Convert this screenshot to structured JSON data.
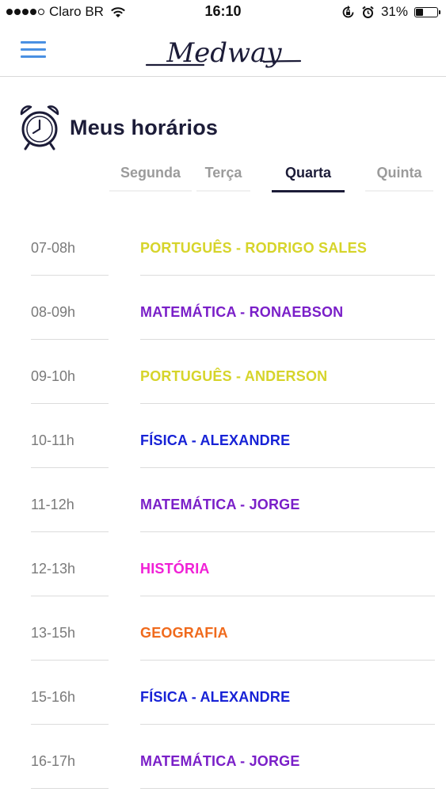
{
  "status_bar": {
    "carrier": "Claro BR",
    "time": "16:10",
    "battery_text": "31%",
    "battery_level": 0.31
  },
  "nav": {
    "logo_text": "Medway"
  },
  "page": {
    "title": "Meus horários"
  },
  "tabs": [
    {
      "label": "Segunda",
      "active": false
    },
    {
      "label": "Terça",
      "active": false
    },
    {
      "label": "Quarta",
      "active": true
    },
    {
      "label": "Quinta",
      "active": false
    }
  ],
  "schedule": [
    {
      "time": "07-08h",
      "class": "PORTUGUÊS - RODRIGO SALES",
      "color": "#d6d42a"
    },
    {
      "time": "08-09h",
      "class": "MATEMÁTICA - RONAEBSON",
      "color": "#7a1fc8"
    },
    {
      "time": "09-10h",
      "class": "PORTUGUÊS - ANDERSON",
      "color": "#d6d42a"
    },
    {
      "time": "10-11h",
      "class": "FÍSICA - ALEXANDRE",
      "color": "#1722d6"
    },
    {
      "time": "11-12h",
      "class": "MATEMÁTICA - JORGE",
      "color": "#7a1fc8"
    },
    {
      "time": "12-13h",
      "class": "HISTÓRIA",
      "color": "#f020d6"
    },
    {
      "time": "13-15h",
      "class": "GEOGRAFIA",
      "color": "#f06a1c"
    },
    {
      "time": "15-16h",
      "class": "FÍSICA - ALEXANDRE",
      "color": "#1722d6"
    },
    {
      "time": "16-17h",
      "class": "MATEMÁTICA - JORGE",
      "color": "#7a1fc8"
    }
  ]
}
